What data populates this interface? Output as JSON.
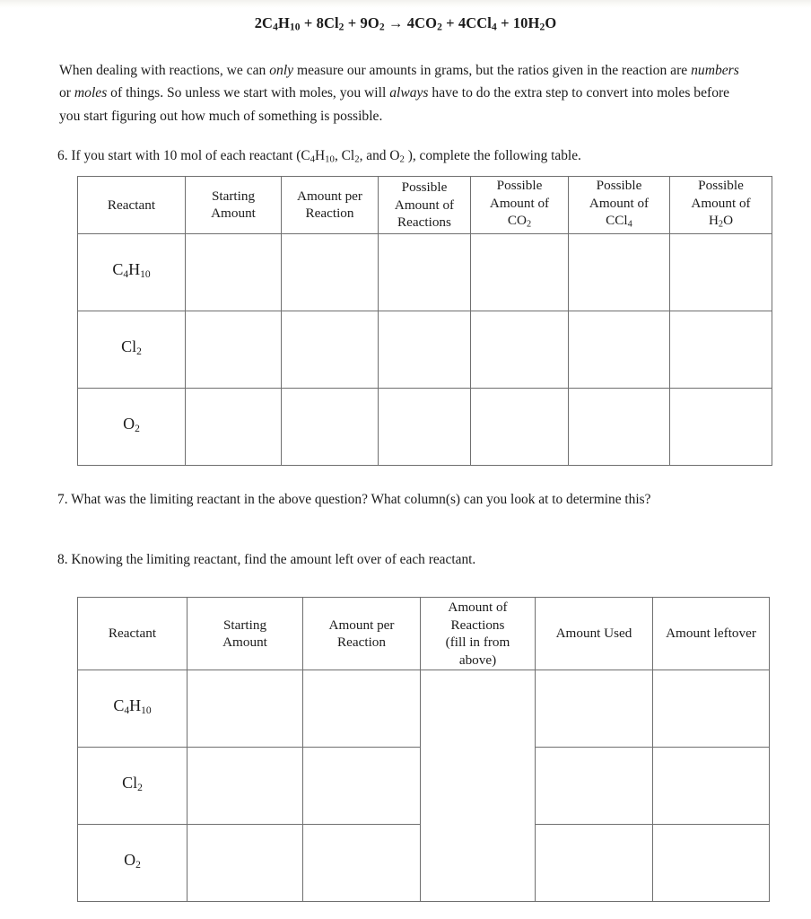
{
  "equation": {
    "parts": [
      {
        "coef": "2",
        "formula": "C",
        "sub1": "4",
        "el2": "H",
        "sub2": "10"
      },
      {
        "coef": "8",
        "formula": "Cl",
        "sub1": "2"
      },
      {
        "coef": "9",
        "formula": "O",
        "sub1": "2"
      },
      {
        "coef": "4",
        "formula": "CO",
        "sub1": "2"
      },
      {
        "coef": "4",
        "formula": "CCl",
        "sub1": "4"
      },
      {
        "coef": "10",
        "formula": "H",
        "sub1": "2",
        "el2": "O"
      }
    ],
    "plus": "+",
    "arrow": "→",
    "full_text": "2C4H10 + 8Cl2 + 9O2 → 4CO2 + 4CCl4 + 10H2O"
  },
  "intro": {
    "s1": "When dealing with reactions, we can ",
    "em1": "only",
    "s2": " measure our amounts in grams, but the ratios given in the reaction are ",
    "em2": "numbers",
    "s3": " or ",
    "em3": "moles",
    "s4": " of things. So unless we start with moles, you will ",
    "em4": "always",
    "s5": " have to do the extra step to convert into moles before you start figuring out how much of something is possible."
  },
  "questions": {
    "q6_a": "6. If you start with 10 mol of each reactant (C",
    "q6_sub1": "4",
    "q6_b": "H",
    "q6_sub2": "10",
    "q6_c": ", Cl",
    "q6_sub3": "2",
    "q6_d": ", and O",
    "q6_sub4": "2",
    "q6_e": " ), complete the following table.",
    "q6_full": "6. If you start with 10 mol of each reactant (C4H10, Cl2, and O2), complete the following table.",
    "q7": "7. What was the limiting reactant in the above question? What column(s) can you look at to determine this?",
    "q8": "8. Knowing the limiting reactant, find the amount left over of each reactant."
  },
  "table1": {
    "headers": [
      {
        "line1": "Reactant",
        "line2": "",
        "line3": ""
      },
      {
        "line1": "Starting",
        "line2": "Amount",
        "line3": ""
      },
      {
        "line1": "Amount per",
        "line2": "Reaction",
        "line3": ""
      },
      {
        "line1": "Possible",
        "line2": "Amount of",
        "line3": "Reactions"
      },
      {
        "line1": "Possible",
        "line2": "Amount of",
        "line3": "CO",
        "sub3": "2"
      },
      {
        "line1": "Possible",
        "line2": "Amount of",
        "line3": "CCl",
        "sub3": "4"
      },
      {
        "line1": "Possible",
        "line2": "Amount of",
        "line3": "H",
        "sub3": "2",
        "tail3": "O"
      }
    ],
    "rows": [
      {
        "reactant_el1": "C",
        "reactant_sub1": "4",
        "reactant_el2": "H",
        "reactant_sub2": "10",
        "label": "C4H10",
        "starting_amount": "",
        "amount_per_reaction": "",
        "possible_reactions": "",
        "possible_co2": "",
        "possible_ccl4": "",
        "possible_h2o": ""
      },
      {
        "reactant_el1": "Cl",
        "reactant_sub1": "2",
        "reactant_el2": "",
        "reactant_sub2": "",
        "label": "Cl2",
        "starting_amount": "",
        "amount_per_reaction": "",
        "possible_reactions": "",
        "possible_co2": "",
        "possible_ccl4": "",
        "possible_h2o": ""
      },
      {
        "reactant_el1": "O",
        "reactant_sub1": "2",
        "reactant_el2": "",
        "reactant_sub2": "",
        "label": "O2",
        "starting_amount": "",
        "amount_per_reaction": "",
        "possible_reactions": "",
        "possible_co2": "",
        "possible_ccl4": "",
        "possible_h2o": ""
      }
    ]
  },
  "table2": {
    "headers": [
      {
        "line1": "Reactant",
        "line2": "",
        "line3": "",
        "line4": ""
      },
      {
        "line1": "Starting",
        "line2": "Amount",
        "line3": "",
        "line4": ""
      },
      {
        "line1": "Amount per",
        "line2": "Reaction",
        "line3": "",
        "line4": ""
      },
      {
        "line1": "Amount of",
        "line2": "Reactions",
        "line3": "(fill in from",
        "line4": "above)"
      },
      {
        "line1": "Amount Used",
        "line2": "",
        "line3": "",
        "line4": ""
      },
      {
        "line1": "Amount leftover",
        "line2": "",
        "line3": "",
        "line4": ""
      }
    ],
    "rows": [
      {
        "reactant_el1": "C",
        "reactant_sub1": "4",
        "reactant_el2": "H",
        "reactant_sub2": "10",
        "label": "C4H10",
        "starting_amount": "",
        "amount_per_reaction": "",
        "amount_used": "",
        "amount_leftover": ""
      },
      {
        "reactant_el1": "Cl",
        "reactant_sub1": "2",
        "reactant_el2": "",
        "reactant_sub2": "",
        "label": "Cl2",
        "starting_amount": "",
        "amount_per_reaction": "",
        "amount_used": "",
        "amount_leftover": ""
      },
      {
        "reactant_el1": "O",
        "reactant_sub1": "2",
        "reactant_el2": "",
        "reactant_sub2": "",
        "label": "O2",
        "starting_amount": "",
        "amount_per_reaction": "",
        "amount_used": "",
        "amount_leftover": ""
      }
    ],
    "merged_reactions_cell": ""
  }
}
